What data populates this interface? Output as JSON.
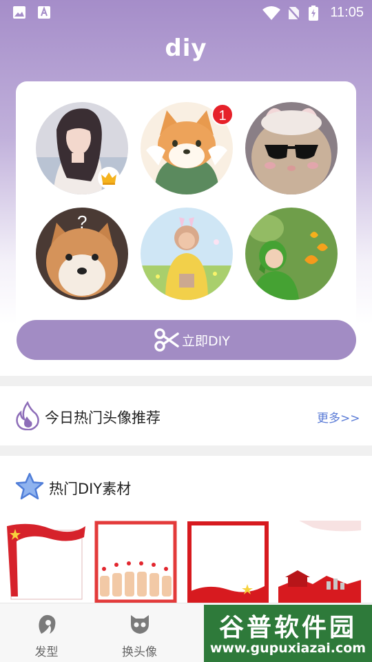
{
  "status_bar": {
    "time": "11:05",
    "icons": [
      "image-icon",
      "font-icon",
      "wifi-icon",
      "no-sim-icon",
      "battery-charging-icon"
    ]
  },
  "header": {
    "logo_text": "diy"
  },
  "avatars": [
    {
      "name": "avatar-girl",
      "badge": "crown"
    },
    {
      "name": "avatar-shiba-cartoon",
      "badge_count": "1"
    },
    {
      "name": "avatar-cat-sunglasses"
    },
    {
      "name": "avatar-shiba-question",
      "overlay_text": "?"
    },
    {
      "name": "avatar-teletubby-yellow"
    },
    {
      "name": "avatar-teletubby-green"
    }
  ],
  "diy_button": {
    "label": "立即DIY",
    "icon": "scissors-icon"
  },
  "hot_avatars": {
    "title": "今日热门头像推荐",
    "more": "更多>>",
    "icon": "flame-icon"
  },
  "hot_materials": {
    "title": "热门DIY素材",
    "icon": "star-icon",
    "items": [
      "flag-frame",
      "thumbs-up-hearts-frame",
      "red-frame",
      "tiananmen-frame"
    ]
  },
  "tabs": [
    {
      "label": "发型",
      "icon": "hair-icon"
    },
    {
      "label": "换头像",
      "icon": "mask-icon"
    }
  ],
  "watermark": {
    "main": "谷普软件园",
    "url": "www.gupuxiazai.com"
  },
  "colors": {
    "accent": "#a28cc4",
    "link": "#5a7bd6",
    "badge": "#e62129"
  }
}
